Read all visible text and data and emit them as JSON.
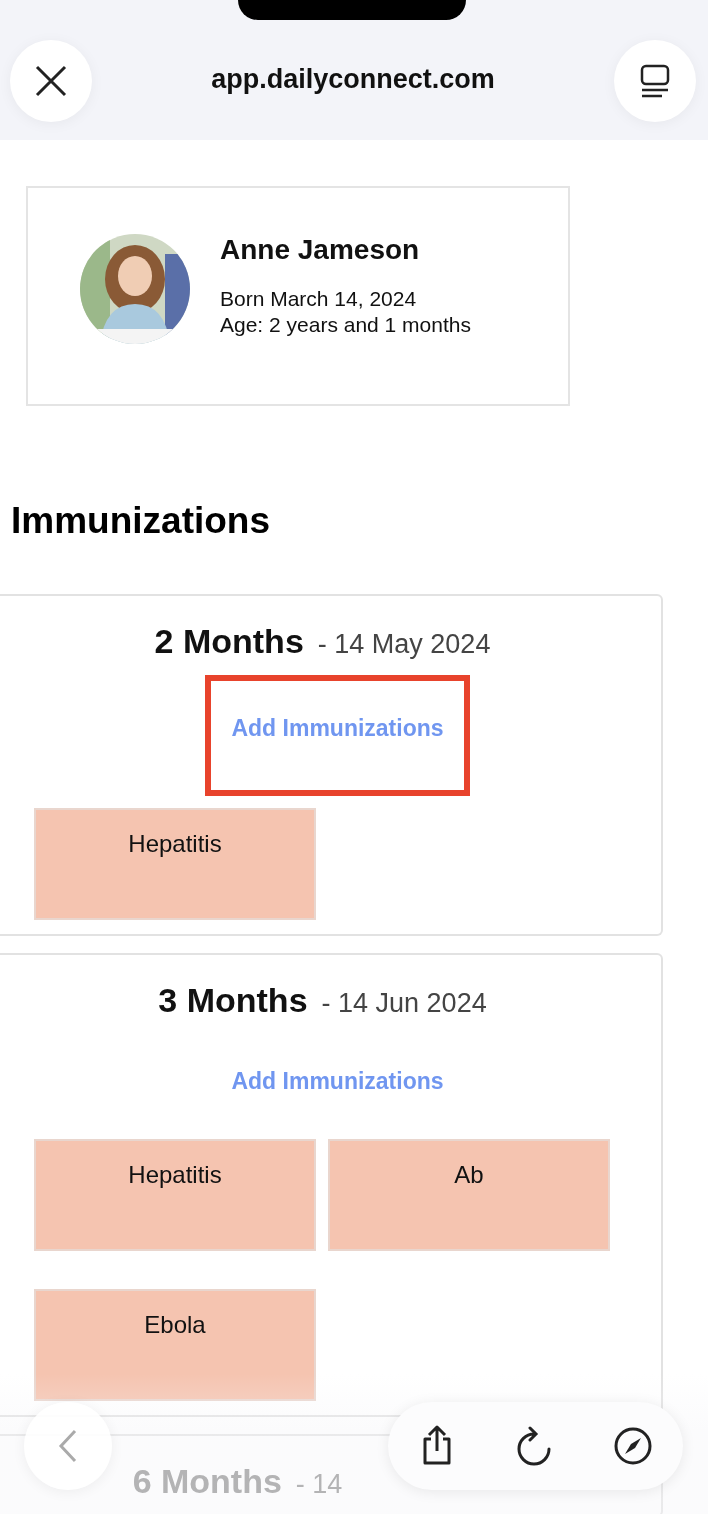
{
  "browser": {
    "address": "app.dailyconnect.com"
  },
  "profile": {
    "name": "Anne Jameson",
    "born": "Born March 14, 2024",
    "age": "Age: 2 years and 1 months"
  },
  "heading": "Immunizations",
  "sections": [
    {
      "title": "2 Months",
      "date": "- 14 May 2024",
      "add_link": {
        "text": "Add Immunizations",
        "highlighted": true
      },
      "immunizations": [
        "Hepatitis"
      ]
    },
    {
      "title": "3 Months",
      "date": "- 14 Jun 2024",
      "add_link": {
        "text": "Add Immunizations",
        "highlighted": false
      },
      "immunizations": [
        "Hepatitis",
        "Ab",
        "Ebola"
      ]
    },
    {
      "title": "6 Months",
      "date": "- 14"
    }
  ]
}
